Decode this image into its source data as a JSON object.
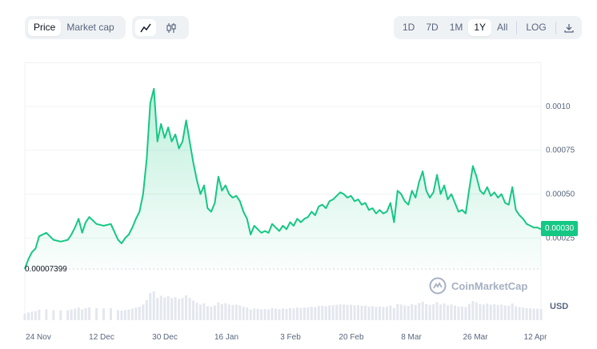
{
  "toolbar": {
    "metric_tabs": [
      {
        "label": "Price",
        "active": true
      },
      {
        "label": "Market cap",
        "active": false
      }
    ],
    "chart_mode_icons": [
      {
        "name": "line-chart-icon",
        "active": true
      },
      {
        "name": "candlestick-icon",
        "active": false
      }
    ],
    "ranges": [
      {
        "label": "1D",
        "active": false
      },
      {
        "label": "7D",
        "active": false
      },
      {
        "label": "1M",
        "active": false
      },
      {
        "label": "1Y",
        "active": true
      },
      {
        "label": "All",
        "active": false
      }
    ],
    "log_label": "LOG",
    "download_icon": "download-icon"
  },
  "watermark": "CoinMarketCap",
  "currency_label": "USD",
  "min_label": "0.00007399",
  "current_label": "0.00030",
  "colors": {
    "line": "#16c784",
    "badge": "#16c784",
    "grid": "#eff2f5",
    "volume": "#e3e7ee"
  },
  "chart_data": {
    "type": "area",
    "title": "",
    "xlabel": "",
    "ylabel": "",
    "x_ticks": [
      "24 Nov",
      "12 Dec",
      "30 Dec",
      "16 Jan",
      "3 Feb",
      "20 Feb",
      "8 Mar",
      "26 Mar",
      "12 Apr"
    ],
    "y_ticks": [
      "0.0010",
      "0.00075",
      "0.00050",
      "0.00025"
    ],
    "ylim": [
      7.399e-05,
      0.00125
    ],
    "x_range": [
      "2023-11-24",
      "2024-04-16"
    ],
    "grid": true,
    "series": [
      {
        "points": [
          [
            "2023-11-24",
            7.399e-05
          ],
          [
            "2023-11-25",
            0.00013
          ],
          [
            "2023-11-26",
            0.00017
          ],
          [
            "2023-11-27",
            0.00019
          ],
          [
            "2023-11-28",
            0.00026
          ],
          [
            "2023-11-30",
            0.00028
          ],
          [
            "2023-12-02",
            0.00024
          ],
          [
            "2023-12-04",
            0.00023
          ],
          [
            "2023-12-06",
            0.00024
          ],
          [
            "2023-12-07",
            0.00027
          ],
          [
            "2023-12-08",
            0.00031
          ],
          [
            "2023-12-09",
            0.00036
          ],
          [
            "2023-12-10",
            0.00028
          ],
          [
            "2023-12-11",
            0.00034
          ],
          [
            "2023-12-12",
            0.00037
          ],
          [
            "2023-12-14",
            0.00033
          ],
          [
            "2023-12-16",
            0.00032
          ],
          [
            "2023-12-18",
            0.00033
          ],
          [
            "2023-12-20",
            0.00024
          ],
          [
            "2023-12-21",
            0.00022
          ],
          [
            "2023-12-22",
            0.00025
          ],
          [
            "2023-12-23",
            0.00027
          ],
          [
            "2023-12-24",
            0.00031
          ],
          [
            "2023-12-25",
            0.00036
          ],
          [
            "2023-12-26",
            0.0004
          ],
          [
            "2023-12-27",
            0.0005
          ],
          [
            "2023-12-28",
            0.0007
          ],
          [
            "2023-12-29",
            0.00102
          ],
          [
            "2023-12-30",
            0.0011
          ],
          [
            "2023-12-31",
            0.0008
          ],
          [
            "2024-01-01",
            0.0009
          ],
          [
            "2024-01-02",
            0.00082
          ],
          [
            "2024-01-03",
            0.00088
          ],
          [
            "2024-01-04",
            0.0008
          ],
          [
            "2024-01-05",
            0.00084
          ],
          [
            "2024-01-06",
            0.00076
          ],
          [
            "2024-01-07",
            0.0008
          ],
          [
            "2024-01-08",
            0.00092
          ],
          [
            "2024-01-09",
            0.0008
          ],
          [
            "2024-01-10",
            0.00068
          ],
          [
            "2024-01-11",
            0.00058
          ],
          [
            "2024-01-12",
            0.0005
          ],
          [
            "2024-01-13",
            0.00055
          ],
          [
            "2024-01-14",
            0.00042
          ],
          [
            "2024-01-15",
            0.0004
          ],
          [
            "2024-01-16",
            0.00045
          ],
          [
            "2024-01-17",
            0.0006
          ],
          [
            "2024-01-18",
            0.00052
          ],
          [
            "2024-01-19",
            0.00055
          ],
          [
            "2024-01-20",
            0.0005
          ],
          [
            "2024-01-21",
            0.00048
          ],
          [
            "2024-01-22",
            0.00049
          ],
          [
            "2024-01-23",
            0.00046
          ],
          [
            "2024-01-24",
            0.0004
          ],
          [
            "2024-01-25",
            0.00036
          ],
          [
            "2024-01-26",
            0.00027
          ],
          [
            "2024-01-27",
            0.00032
          ],
          [
            "2024-01-28",
            0.0003
          ],
          [
            "2024-01-29",
            0.00028
          ],
          [
            "2024-01-30",
            0.00029
          ],
          [
            "2024-01-31",
            0.00028
          ],
          [
            "2024-02-01",
            0.00033
          ],
          [
            "2024-02-02",
            0.00031
          ],
          [
            "2024-02-03",
            0.00029
          ],
          [
            "2024-02-04",
            0.00032
          ],
          [
            "2024-02-05",
            0.0003
          ],
          [
            "2024-02-06",
            0.00034
          ],
          [
            "2024-02-07",
            0.00032
          ],
          [
            "2024-02-08",
            0.00036
          ],
          [
            "2024-02-09",
            0.00034
          ],
          [
            "2024-02-10",
            0.00036
          ],
          [
            "2024-02-11",
            0.00037
          ],
          [
            "2024-02-12",
            0.0004
          ],
          [
            "2024-02-13",
            0.00038
          ],
          [
            "2024-02-14",
            0.00043
          ],
          [
            "2024-02-15",
            0.00044
          ],
          [
            "2024-02-16",
            0.00042
          ],
          [
            "2024-02-17",
            0.00046
          ],
          [
            "2024-02-18",
            0.00047
          ],
          [
            "2024-02-19",
            0.00049
          ],
          [
            "2024-02-20",
            0.00051
          ],
          [
            "2024-02-21",
            0.0005
          ],
          [
            "2024-02-22",
            0.00048
          ],
          [
            "2024-02-23",
            0.00049
          ],
          [
            "2024-02-24",
            0.00046
          ],
          [
            "2024-02-25",
            0.00047
          ],
          [
            "2024-02-26",
            0.00044
          ],
          [
            "2024-02-27",
            0.00045
          ],
          [
            "2024-02-28",
            0.00041
          ],
          [
            "2024-02-29",
            0.00042
          ],
          [
            "2024-03-01",
            0.00039
          ],
          [
            "2024-03-02",
            0.00041
          ],
          [
            "2024-03-03",
            0.00039
          ],
          [
            "2024-03-04",
            0.0004
          ],
          [
            "2024-03-05",
            0.00045
          ],
          [
            "2024-03-06",
            0.00034
          ],
          [
            "2024-03-07",
            0.00052
          ],
          [
            "2024-03-08",
            0.0005
          ],
          [
            "2024-03-09",
            0.00046
          ],
          [
            "2024-03-10",
            0.00044
          ],
          [
            "2024-03-11",
            0.00052
          ],
          [
            "2024-03-12",
            0.00048
          ],
          [
            "2024-03-13",
            0.00057
          ],
          [
            "2024-03-14",
            0.00063
          ],
          [
            "2024-03-15",
            0.00052
          ],
          [
            "2024-03-16",
            0.00048
          ],
          [
            "2024-03-17",
            0.00051
          ],
          [
            "2024-03-18",
            0.00061
          ],
          [
            "2024-03-19",
            0.0005
          ],
          [
            "2024-03-20",
            0.00055
          ],
          [
            "2024-03-21",
            0.00047
          ],
          [
            "2024-03-22",
            0.0005
          ],
          [
            "2024-03-23",
            0.00045
          ],
          [
            "2024-03-24",
            0.0004
          ],
          [
            "2024-03-25",
            0.00041
          ],
          [
            "2024-03-26",
            0.00039
          ],
          [
            "2024-03-27",
            0.00053
          ],
          [
            "2024-03-28",
            0.00066
          ],
          [
            "2024-03-29",
            0.0006
          ],
          [
            "2024-03-30",
            0.00052
          ],
          [
            "2024-03-31",
            0.0005
          ],
          [
            "2024-04-01",
            0.00054
          ],
          [
            "2024-04-02",
            0.00049
          ],
          [
            "2024-04-03",
            0.00051
          ],
          [
            "2024-04-04",
            0.00048
          ],
          [
            "2024-04-05",
            0.0005
          ],
          [
            "2024-04-06",
            0.00045
          ],
          [
            "2024-04-07",
            0.00044
          ],
          [
            "2024-04-08",
            0.00054
          ],
          [
            "2024-04-09",
            0.00041
          ],
          [
            "2024-04-10",
            0.00038
          ],
          [
            "2024-04-11",
            0.00036
          ],
          [
            "2024-04-12",
            0.00033
          ],
          [
            "2024-04-13",
            0.00032
          ],
          [
            "2024-04-14",
            0.00031
          ],
          [
            "2024-04-15",
            0.00031
          ],
          [
            "2024-04-16",
            0.0003
          ]
        ]
      }
    ]
  }
}
